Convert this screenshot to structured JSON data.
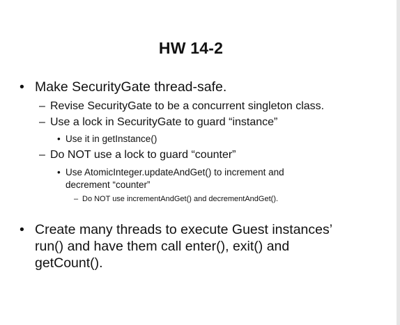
{
  "slide": {
    "title": "HW 14-2",
    "bullets": [
      {
        "marker": "•",
        "text": "Make SecurityGate thread-safe."
      },
      {
        "marker": "–",
        "text": "Revise SecurityGate to be a concurrent singleton class."
      },
      {
        "marker": "–",
        "text": "Use a lock in SecurityGate to guard “instance”"
      },
      {
        "marker": "•",
        "text": "Use it in getInstance()"
      },
      {
        "marker": "–",
        "text": "Do NOT use a lock to guard “counter”"
      },
      {
        "marker": "•",
        "lines": [
          "Use AtomicInteger.updateAndGet() to increment and",
          "decrement “counter”"
        ]
      },
      {
        "marker": "–",
        "text": "Do NOT use incrementAndGet() and decrementAndGet()."
      },
      {
        "marker": "•",
        "lines": [
          "Create many threads to execute Guest instances’",
          "run() and have them call enter(), exit() and",
          "getCount()."
        ]
      }
    ]
  }
}
